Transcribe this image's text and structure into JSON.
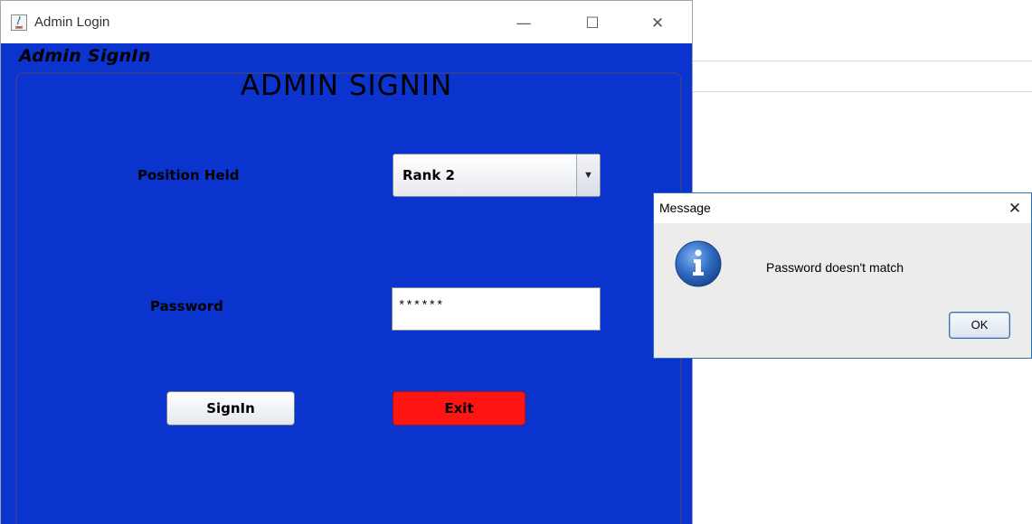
{
  "window": {
    "title": "Admin Login",
    "controls": {
      "minimize": "—",
      "maximize": "☐",
      "close": "✕"
    }
  },
  "header": {
    "label": "Admin SignIn"
  },
  "form": {
    "title": "ADMIN SIGNIN",
    "position_label": "Position Held",
    "position_value": "Rank 2",
    "password_label": "Password",
    "password_value": "******",
    "signin_label": "SignIn",
    "exit_label": "Exit"
  },
  "dialog": {
    "title": "Message",
    "close": "✕",
    "message": "Password doesn't match",
    "ok_label": "OK"
  },
  "colors": {
    "panel_bg": "#0b34cf",
    "exit_button": "#ff1414",
    "dialog_border": "#2f6fb6"
  }
}
